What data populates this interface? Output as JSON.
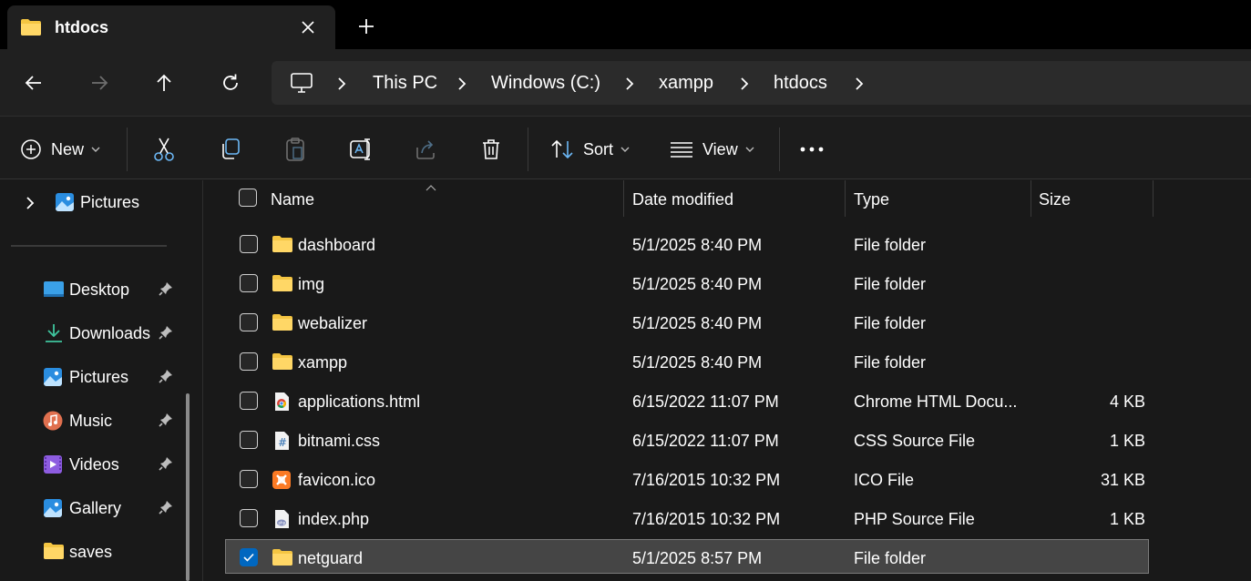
{
  "window": {
    "tab_title": "htdocs",
    "tab_icon": "folder-icon",
    "close_label": "close",
    "new_tab_label": "+"
  },
  "nav": {
    "back": "back-arrow",
    "forward": "forward-arrow",
    "up": "up-arrow",
    "refresh": "refresh"
  },
  "breadcrumb": [
    "This PC",
    "Windows (C:)",
    "xampp",
    "htdocs"
  ],
  "toolbar": {
    "new_label": "New",
    "sort_label": "Sort",
    "view_label": "View",
    "more_label": "•••"
  },
  "sidebar": {
    "top_item": {
      "label": "Pictures",
      "icon": "pictures-icon"
    },
    "quick_access": [
      {
        "label": "Desktop",
        "icon": "desktop-icon",
        "pinned": true
      },
      {
        "label": "Downloads",
        "icon": "downloads-icon",
        "pinned": true
      },
      {
        "label": "Pictures",
        "icon": "pictures-icon",
        "pinned": true
      },
      {
        "label": "Music",
        "icon": "music-icon",
        "pinned": true
      },
      {
        "label": "Videos",
        "icon": "videos-icon",
        "pinned": true
      },
      {
        "label": "Gallery",
        "icon": "gallery-icon",
        "pinned": true
      },
      {
        "label": "saves",
        "icon": "folder-icon",
        "pinned": false
      }
    ]
  },
  "columns": {
    "name": "Name",
    "date": "Date modified",
    "type": "Type",
    "size": "Size"
  },
  "files": [
    {
      "name": "dashboard",
      "date": "5/1/2025 8:40 PM",
      "type": "File folder",
      "size": "",
      "icon": "folder",
      "selected": false
    },
    {
      "name": "img",
      "date": "5/1/2025 8:40 PM",
      "type": "File folder",
      "size": "",
      "icon": "folder",
      "selected": false
    },
    {
      "name": "webalizer",
      "date": "5/1/2025 8:40 PM",
      "type": "File folder",
      "size": "",
      "icon": "folder",
      "selected": false
    },
    {
      "name": "xampp",
      "date": "5/1/2025 8:40 PM",
      "type": "File folder",
      "size": "",
      "icon": "folder",
      "selected": false
    },
    {
      "name": "applications.html",
      "date": "6/15/2022 11:07 PM",
      "type": "Chrome HTML Docu...",
      "size": "4 KB",
      "icon": "chrome",
      "selected": false
    },
    {
      "name": "bitnami.css",
      "date": "6/15/2022 11:07 PM",
      "type": "CSS Source File",
      "size": "1 KB",
      "icon": "css",
      "selected": false
    },
    {
      "name": "favicon.ico",
      "date": "7/16/2015 10:32 PM",
      "type": "ICO File",
      "size": "31 KB",
      "icon": "xampp",
      "selected": false
    },
    {
      "name": "index.php",
      "date": "7/16/2015 10:32 PM",
      "type": "PHP Source File",
      "size": "1 KB",
      "icon": "php",
      "selected": false
    },
    {
      "name": "netguard",
      "date": "5/1/2025 8:57 PM",
      "type": "File folder",
      "size": "",
      "icon": "folder",
      "selected": true
    }
  ],
  "colors": {
    "accent": "#0067c0",
    "folder": "#f4c542",
    "selection_bg": "#454545"
  }
}
